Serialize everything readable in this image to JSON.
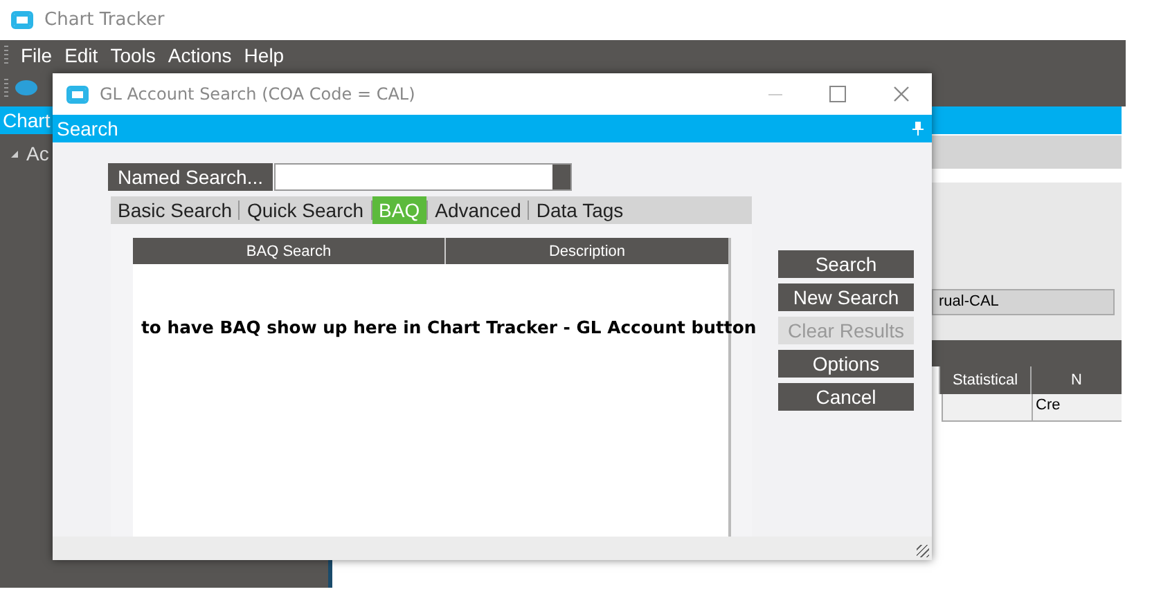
{
  "app": {
    "title": "Chart Tracker",
    "menu": [
      "File",
      "Edit",
      "Tools",
      "Actions",
      "Help"
    ],
    "panel_tab": "Chart",
    "tree_item": "Ac",
    "field_value": "rual-CAL",
    "table": {
      "columns": [
        "Statistical",
        "N"
      ],
      "rows": [
        [
          "",
          "Cre"
        ]
      ]
    }
  },
  "dialog": {
    "title": "GL Account Search (COA Code = CAL)",
    "header": "Search",
    "named_search": "Named Search...",
    "tabs": [
      {
        "label": "Basic Search",
        "selected": false
      },
      {
        "label": "Quick Search",
        "selected": false
      },
      {
        "label": "BAQ",
        "selected": true
      },
      {
        "label": "Advanced",
        "selected": false
      },
      {
        "label": "Data Tags",
        "selected": false
      }
    ],
    "grid": {
      "columns": [
        "BAQ Search",
        "Description"
      ],
      "note": "to have BAQ show up here in Chart Tracker - GL Account button"
    },
    "buttons": [
      {
        "label": "Search",
        "disabled": false
      },
      {
        "label": "New Search",
        "disabled": false
      },
      {
        "label": "Clear Results",
        "disabled": true
      },
      {
        "label": "Options",
        "disabled": false
      },
      {
        "label": "Cancel",
        "disabled": false
      }
    ]
  }
}
